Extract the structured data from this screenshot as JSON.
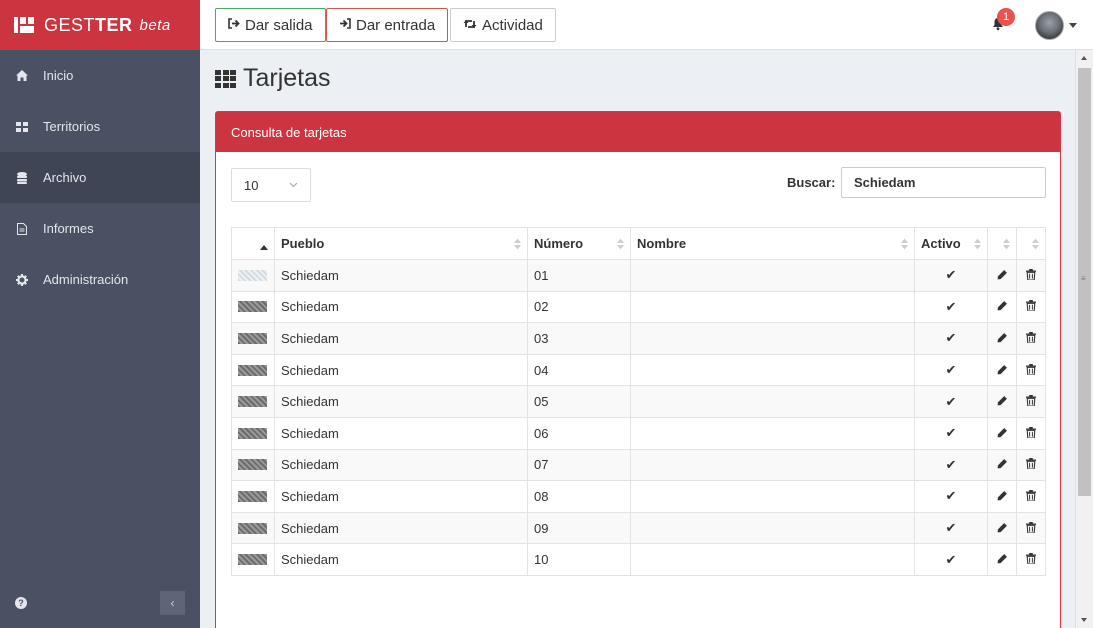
{
  "brand": {
    "name_light": "GEST",
    "name_bold": "TER",
    "suffix": "beta"
  },
  "sidebar": {
    "items": [
      {
        "label": "Inicio",
        "icon": "home-icon"
      },
      {
        "label": "Territorios",
        "icon": "grid-icon"
      },
      {
        "label": "Archivo",
        "icon": "database-icon",
        "active": true
      },
      {
        "label": "Informes",
        "icon": "file-icon"
      },
      {
        "label": "Administración",
        "icon": "gear-icon"
      }
    ],
    "footer": {
      "help_icon": "question-icon",
      "collapse_icon": "chevron-left-icon",
      "collapse_label": "‹"
    }
  },
  "topbar": {
    "buttons": [
      {
        "label": "Dar salida",
        "icon": "sign-out-icon",
        "color": "#4aa865"
      },
      {
        "label": "Dar entrada",
        "icon": "sign-in-icon",
        "color": "#d9534f"
      },
      {
        "label": "Actividad",
        "icon": "retweet-icon",
        "color": "#cccccc"
      }
    ],
    "notifications": {
      "icon": "bell-icon",
      "count": "1"
    },
    "user": {
      "icon": "avatar",
      "menu_icon": "caret-down-icon"
    }
  },
  "page": {
    "title": "Tarjetas",
    "title_icon": "th-icon"
  },
  "panel": {
    "header": "Consulta de tarjetas",
    "page_length": "10",
    "search_label": "Buscar:",
    "search_value": "Schiedam",
    "accent_color": "#cc3440"
  },
  "table": {
    "columns": [
      "",
      "Pueblo",
      "Número",
      "Nombre",
      "Activo",
      "",
      ""
    ],
    "rows": [
      {
        "pueblo": "Schiedam",
        "numero": "01",
        "nombre": "",
        "activo": "✔"
      },
      {
        "pueblo": "Schiedam",
        "numero": "02",
        "nombre": "",
        "activo": "✔"
      },
      {
        "pueblo": "Schiedam",
        "numero": "03",
        "nombre": "",
        "activo": "✔"
      },
      {
        "pueblo": "Schiedam",
        "numero": "04",
        "nombre": "",
        "activo": "✔"
      },
      {
        "pueblo": "Schiedam",
        "numero": "05",
        "nombre": "",
        "activo": "✔"
      },
      {
        "pueblo": "Schiedam",
        "numero": "06",
        "nombre": "",
        "activo": "✔"
      },
      {
        "pueblo": "Schiedam",
        "numero": "07",
        "nombre": "",
        "activo": "✔"
      },
      {
        "pueblo": "Schiedam",
        "numero": "08",
        "nombre": "",
        "activo": "✔"
      },
      {
        "pueblo": "Schiedam",
        "numero": "09",
        "nombre": "",
        "activo": "✔"
      },
      {
        "pueblo": "Schiedam",
        "numero": "10",
        "nombre": "",
        "activo": "✔"
      }
    ],
    "edit_icon": "pencil-icon",
    "delete_icon": "trash-icon"
  }
}
